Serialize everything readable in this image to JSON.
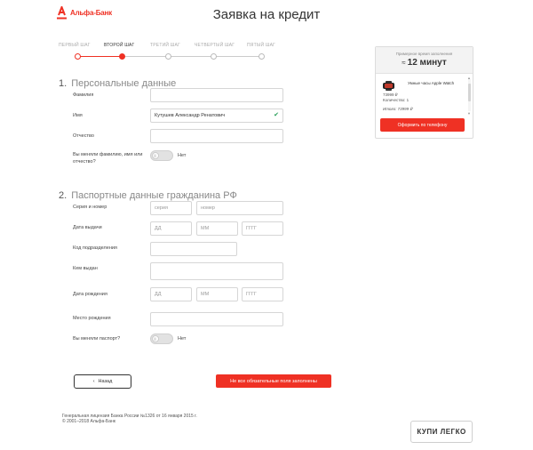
{
  "header": {
    "logo_text": "Альфа-Банк",
    "title": "Заявка на кредит"
  },
  "stepper": {
    "steps": [
      {
        "label": "ПЕРВЫЙ ШАГ",
        "state": "done"
      },
      {
        "label": "ВТОРОЙ ШАГ",
        "state": "current"
      },
      {
        "label": "ТРЕТИЙ ШАГ",
        "state": "pending"
      },
      {
        "label": "ЧЕТВЕРТЫЙ ШАГ",
        "state": "pending"
      },
      {
        "label": "ПЯТЫЙ ШАГ",
        "state": "pending"
      }
    ]
  },
  "personal": {
    "number": "1.",
    "title": "Персональные данные",
    "surname_label": "Фамилия",
    "surname_value": "",
    "name_label": "Имя",
    "name_value": "Кутушев Александр Ренатович",
    "patronymic_label": "Отчество",
    "patronymic_value": "",
    "changed_name_label": "Вы меняли фамилию, имя или отчество?",
    "changed_name_toggle": "Нет"
  },
  "passport": {
    "number": "2.",
    "title": "Паспортные данные гражданина РФ",
    "series_number_label": "Серия и номер",
    "series_placeholder": "серия",
    "number_placeholder": "номер",
    "issue_date_label": "Дата выдачи",
    "day_placeholder": "ДД",
    "month_placeholder": "ММ",
    "year_placeholder": "ГГГГ",
    "division_code_label": "Код подразделения",
    "issued_by_label": "Кем выдан",
    "birth_date_label": "Дата рождения",
    "birth_place_label": "Место рождения",
    "changed_passport_label": "Вы меняли паспорт?",
    "changed_passport_toggle": "Нет"
  },
  "actions": {
    "back_label": "Назад",
    "submit_label": "Не все обязательные поля заполнены"
  },
  "side_panel": {
    "note": "Примерное время заполнения",
    "approx": "≈",
    "time": "12 минут",
    "product_name": "Умные часы Apple Watch",
    "price": "73999 ₽",
    "quantity": "Количество: 1",
    "total": "Итого: 73999 ₽",
    "phone_button": "Оформить по телефону"
  },
  "footer": {
    "license": "Генеральная лицензия Банка России №1326 от 16 января 2015 г.",
    "copyright": "© 2001–2018 Альфа-Банк",
    "kupi_logo": "КУПИ ЛЕГКО"
  },
  "colors": {
    "accent": "#ef3124",
    "check": "#2aa05a"
  }
}
